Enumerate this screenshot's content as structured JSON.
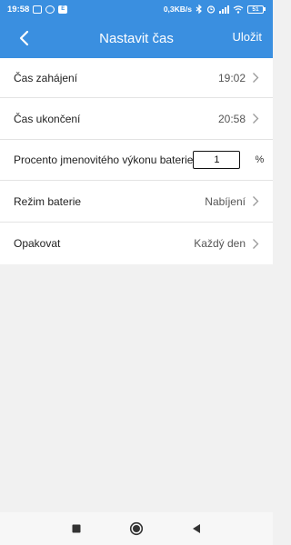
{
  "status_bar": {
    "time": "19:58",
    "speed": "0,3KB/s",
    "battery": "51",
    "app_icons": [
      "mail-icon",
      "sync-icon",
      "app-icon"
    ],
    "right_icons": [
      "bluetooth-icon",
      "alarm-icon",
      "signal-icon",
      "wifi-icon",
      "battery-icon"
    ]
  },
  "header": {
    "title": "Nastavit čas",
    "save_label": "Uložit",
    "back_icon": "back-arrow-icon",
    "background": "#3a8fe0"
  },
  "settings": {
    "start_time": {
      "label": "Čas zahájení",
      "value": "19:02"
    },
    "end_time": {
      "label": "Čas ukončení",
      "value": "20:58"
    },
    "battery_percent": {
      "label": "Procento jmenovitého výkonu baterie",
      "value": "1",
      "unit": "%"
    },
    "battery_mode": {
      "label": "Režim baterie",
      "value": "Nabíjení"
    },
    "repeat": {
      "label": "Opakovat",
      "value": "Každý den"
    }
  },
  "nav_buttons": [
    "recent-apps-icon",
    "home-icon",
    "back-icon"
  ]
}
